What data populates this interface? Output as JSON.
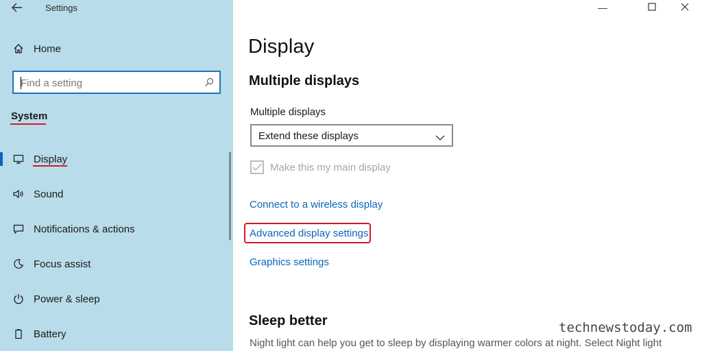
{
  "window": {
    "app_title": "Settings",
    "back_icon": "back-arrow-icon",
    "minimize_glyph": "—",
    "maximize_glyph": "☐",
    "close_glyph": "✕"
  },
  "sidebar": {
    "home": {
      "label": "Home",
      "icon": "home-icon"
    },
    "search": {
      "placeholder": "Find a setting",
      "icon": "search-icon"
    },
    "section_title": "System",
    "items": [
      {
        "label": "Display",
        "icon": "monitor-icon",
        "active": true
      },
      {
        "label": "Sound",
        "icon": "speaker-icon"
      },
      {
        "label": "Notifications & actions",
        "icon": "notification-icon"
      },
      {
        "label": "Focus assist",
        "icon": "moon-icon"
      },
      {
        "label": "Power & sleep",
        "icon": "power-icon"
      },
      {
        "label": "Battery",
        "icon": "battery-icon"
      }
    ]
  },
  "main": {
    "title": "Display",
    "multiple_displays": {
      "heading": "Multiple displays",
      "field_label": "Multiple displays",
      "dropdown_value": "Extend these displays",
      "checkbox_label": "Make this my main display",
      "checkbox_checked": true,
      "checkbox_disabled": true
    },
    "links": {
      "wireless": "Connect to a wireless display",
      "advanced": "Advanced display settings",
      "graphics": "Graphics settings"
    },
    "sleep": {
      "heading": "Sleep better",
      "description": "Night light can help you get to sleep by displaying warmer colors at night. Select Night light"
    }
  },
  "watermark": "technewstoday.com",
  "colors": {
    "sidebar_bg": "#b9dcea",
    "accent": "#0a66b8",
    "highlight": "#d3182a",
    "search_border": "#1a73c2"
  }
}
